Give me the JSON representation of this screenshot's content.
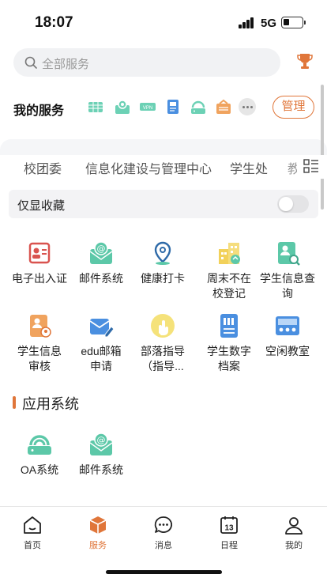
{
  "status_bar": {
    "time": "18:07",
    "network": "5G"
  },
  "search": {
    "placeholder": "全部服务"
  },
  "my_services": {
    "title": "我的服务",
    "manage_label": "管理",
    "icons": [
      "ticket-icon",
      "map-pin-icon",
      "vpn-icon",
      "id-card-icon",
      "router-icon",
      "inbox-icon"
    ]
  },
  "tabs": [
    {
      "label": "校团委"
    },
    {
      "label": "信息化建设与管理中心"
    },
    {
      "label": "学生处"
    },
    {
      "label": "教"
    }
  ],
  "favorites_toggle": {
    "label": "仅显收藏",
    "on": false
  },
  "services": [
    {
      "label": "电子出入证",
      "icon": "pass-card-icon",
      "color": "#d9534f"
    },
    {
      "label": "邮件系统",
      "icon": "mail-icon",
      "color": "#5cc8a8"
    },
    {
      "label": "健康打卡",
      "icon": "location-pin-icon",
      "color": "#2e6aa8"
    },
    {
      "label": "周末不在校登记",
      "icon": "buildings-icon",
      "color": "#f2d15a"
    },
    {
      "label": "学生信息查询",
      "icon": "student-search-icon",
      "color": "#5cc8a8"
    },
    {
      "label": "学生信息审核",
      "icon": "student-review-icon",
      "color": "#f0a35e"
    },
    {
      "label": "edu邮箱申请",
      "icon": "mail-apply-icon",
      "color": "#4a8fe0"
    },
    {
      "label": "部落指导（指导...",
      "icon": "hand-icon",
      "color": "#f5e27a"
    },
    {
      "label": "学生数字档案",
      "icon": "archive-icon",
      "color": "#4a8fe0"
    },
    {
      "label": "空闲教室",
      "icon": "classroom-icon",
      "color": "#4a8fe0"
    }
  ],
  "apps_section": {
    "title": "应用系统",
    "items": [
      {
        "label": "OA系统",
        "icon": "router-icon",
        "color": "#5cc8a8"
      },
      {
        "label": "邮件系统",
        "icon": "mail-icon",
        "color": "#5cc8a8"
      }
    ]
  },
  "bottom_nav": [
    {
      "label": "首页",
      "icon": "home-icon"
    },
    {
      "label": "服务",
      "icon": "cube-icon",
      "active": true
    },
    {
      "label": "消息",
      "icon": "chat-icon"
    },
    {
      "label": "日程",
      "icon": "calendar-icon",
      "badge": "13"
    },
    {
      "label": "我的",
      "icon": "person-icon"
    }
  ],
  "colors": {
    "accent": "#e0763a",
    "mint": "#5cc8a8",
    "blue": "#4a8fe0"
  }
}
